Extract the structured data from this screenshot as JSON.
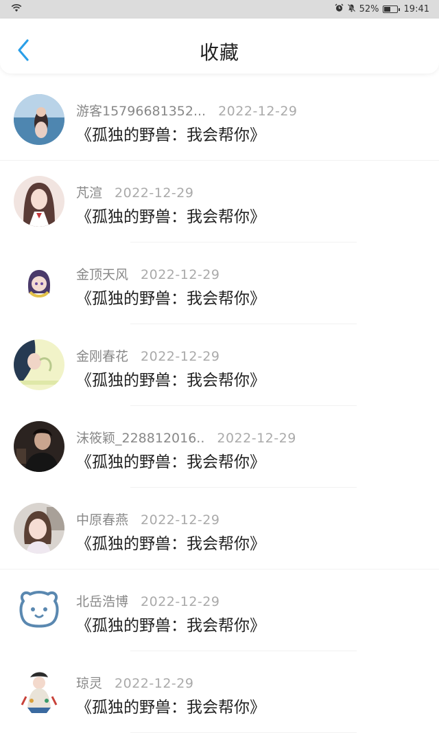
{
  "status_bar": {
    "battery_percent": "52%",
    "battery_level": 0.52,
    "time": "19:41",
    "icons": [
      "wifi-icon",
      "alarm-icon",
      "mute-icon",
      "battery-icon"
    ]
  },
  "header": {
    "title": "收藏",
    "back_icon": "chevron-left-icon",
    "accent_color": "#2a9fe8"
  },
  "favorites": [
    {
      "user": "游客15796681352...",
      "date": "2022-12-29",
      "book": "《孤独的野兽：我会帮你》",
      "avatar": "photo-avatar"
    },
    {
      "user": "芃渲",
      "date": "2022-12-29",
      "book": "《孤独的野兽：我会帮你》",
      "avatar": "anime-girl-avatar"
    },
    {
      "user": "金顶天风",
      "date": "2022-12-29",
      "book": "《孤独的野兽：我会帮你》",
      "avatar": "chibi-avatar"
    },
    {
      "user": "金刚春花",
      "date": "2022-12-29",
      "book": "《孤独的野兽：我会帮你》",
      "avatar": "couple-avatar"
    },
    {
      "user": "沫筱颖_228812016..",
      "date": "2022-12-29",
      "book": "《孤独的野兽：我会帮你》",
      "avatar": "dark-photo-avatar"
    },
    {
      "user": "中原春燕",
      "date": "2022-12-29",
      "book": "《孤独的野兽：我会帮你》",
      "avatar": "child-photo-avatar"
    },
    {
      "user": "北岳浩博",
      "date": "2022-12-29",
      "book": "《孤独的野兽：我会帮你》",
      "avatar": "bear-default-avatar"
    },
    {
      "user": "琼灵",
      "date": "2022-12-29",
      "book": "《孤独的野兽：我会帮你》",
      "avatar": "illustration-avatar"
    }
  ]
}
